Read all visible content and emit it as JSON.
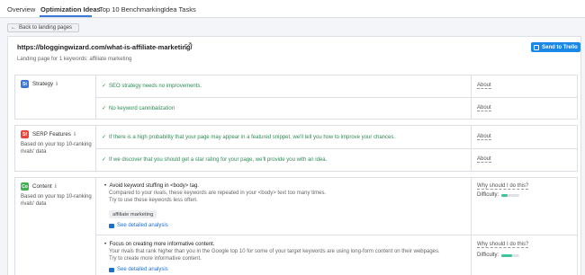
{
  "tabs": [
    "Overview",
    "Optimization Ideas",
    "Top 10 Benchmarking",
    "Idea Tasks"
  ],
  "back_button": "Back to landing pages",
  "page": {
    "url": "https://bloggingwizard.com/what-is-affiliate-marketing/",
    "subtitle": "Landing page for 1 keywords: affiliate marketing",
    "trello_button": "Send to Trello"
  },
  "strategy": {
    "icon_text": "St",
    "icon_color": "#3c78d8",
    "title": "Strategy",
    "rows": [
      {
        "text": "SEO strategy needs no improvements.",
        "action": "About"
      },
      {
        "text": "No keyword cannibalization",
        "action": "About"
      }
    ]
  },
  "serp": {
    "icon_text": "Sf",
    "icon_color": "#e8453c",
    "title": "SERP Features",
    "desc": "Based on your top 10-ranking rivals' data",
    "rows": [
      {
        "text": "If there is a high probability that your page may appear in a featured snippet, we'll tell you how to improve your chances.",
        "action": "About"
      },
      {
        "text": "If we discover that you should get a star rating for your page, we'll provide you with an idea.",
        "action": "About"
      }
    ]
  },
  "content": {
    "icon_text": "Co",
    "icon_color": "#3fb24f",
    "title": "Content",
    "desc": "Based on your top 10-ranking rivals' data",
    "ideas": [
      {
        "title": "Avoid keyword stuffing in <body> tag.",
        "body": [
          "Compared to your rivals, these keywords are repeated in your <body> text too many times.",
          "Try to use these keywords less often."
        ],
        "chip": "affiliate marketing",
        "link": "See detailed analysis",
        "why": "Why should I do this?",
        "difficulty_label": "Difficulty:",
        "difficulty": 0.35
      },
      {
        "title": "Focus on creating more informative content.",
        "body": [
          "Your rivals that rank higher than you in the Google top 10 for some of your target keywords are using long-form content on their webpages.",
          "Try to create more informative content."
        ],
        "link": "See detailed analysis",
        "why": "Why should I do this?",
        "difficulty_label": "Difficulty:",
        "difficulty": 0.6
      }
    ]
  }
}
